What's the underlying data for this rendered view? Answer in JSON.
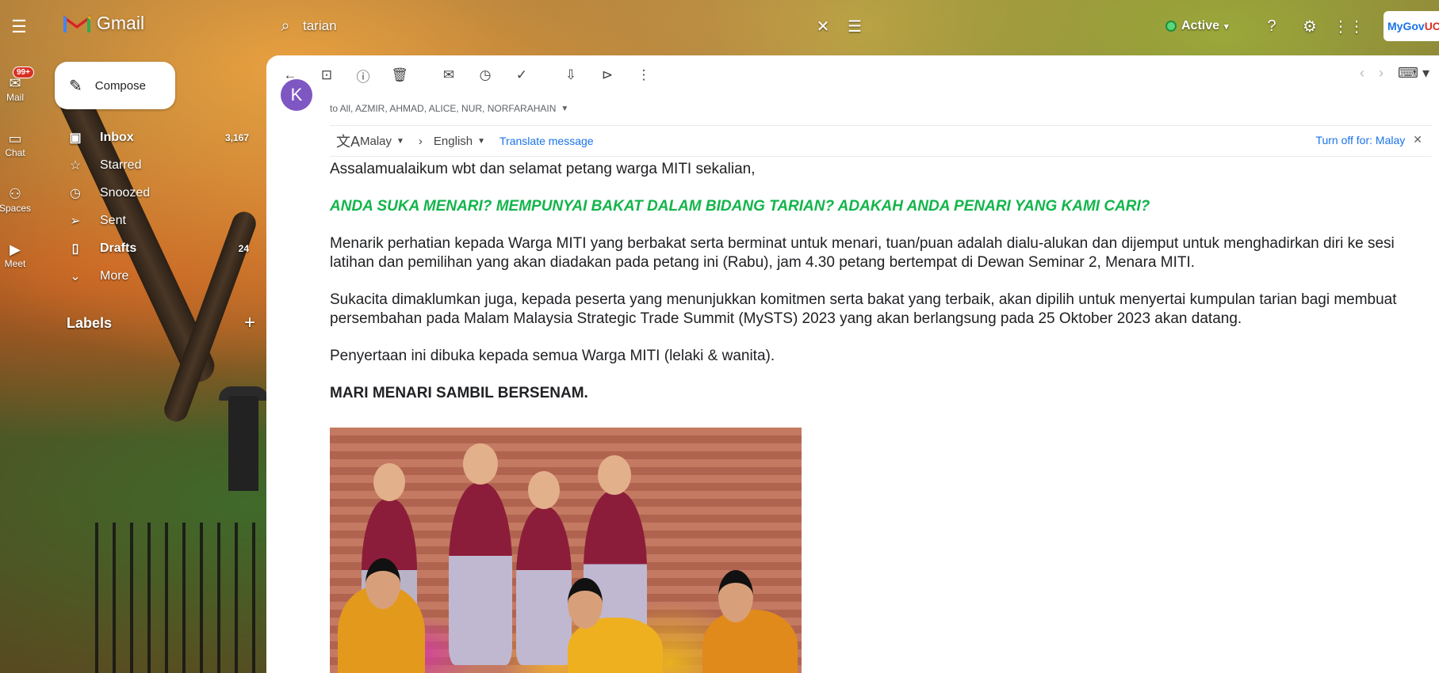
{
  "app": {
    "name": "Gmail"
  },
  "rail": {
    "mail_label": "Mail",
    "mail_badge": "99+",
    "chat_label": "Chat",
    "spaces_label": "Spaces",
    "meet_label": "Meet"
  },
  "search": {
    "value": "tarian"
  },
  "status": {
    "label": "Active",
    "color": "#1e8e3e"
  },
  "account": {
    "org_logo_text": "MyGov",
    "org_logo_suffix": "UC"
  },
  "compose": {
    "label": "Compose"
  },
  "nav": [
    {
      "label": "Inbox",
      "count": "3,167",
      "icon": "inbox-icon"
    },
    {
      "label": "Starred",
      "count": "",
      "icon": "star-icon"
    },
    {
      "label": "Snoozed",
      "count": "",
      "icon": "clock-icon"
    },
    {
      "label": "Sent",
      "count": "",
      "icon": "send-icon"
    },
    {
      "label": "Drafts",
      "count": "24",
      "icon": "draft-icon"
    },
    {
      "label": "More",
      "count": "",
      "icon": "chevron-down-icon"
    }
  ],
  "labels": {
    "heading": "Labels"
  },
  "email": {
    "sender_initial": "K",
    "avatar_color": "#7e57c2",
    "recipients": "to All, AZMIR, AHMAD, ALICE, NUR, NORFARAHAIN",
    "translate": {
      "from_lang": "Malay",
      "to_lang": "English",
      "action": "Translate message",
      "turn_off": "Turn off for: Malay"
    },
    "greeting": "Assalamualaikum wbt dan selamat petang warga MITI sekalian,",
    "headline": "ANDA SUKA MENARI? MEMPUNYAI BAKAT DALAM BIDANG TARIAN? ADAKAH ANDA PENARI YANG KAMI CARI?",
    "headline_color": "#12b54a",
    "para1": "Menarik perhatian kepada Warga MITI yang berbakat serta berminat untuk menari, tuan/puan adalah dialu-alukan dan dijemput untuk menghadirkan diri ke sesi latihan dan pemilihan yang akan diadakan pada petang ini (Rabu), jam 4.30 petang bertempat di Dewan Seminar 2, Menara MITI.",
    "para2": "Sukacita dimaklumkan juga, kepada peserta yang menunjukkan komitmen serta bakat yang terbaik, akan dipilih untuk menyertai kumpulan tarian bagi membuat persembahan pada Malam Malaysia Strategic Trade Summit (MySTS) 2023 yang akan berlangsung pada 25 Oktober 2023 akan datang.",
    "para3": "Penyertaan ini dibuka kepada semua Warga MITI (lelaki & wanita).",
    "closing": "MARI MENARI SAMBIL BERSENAM."
  }
}
